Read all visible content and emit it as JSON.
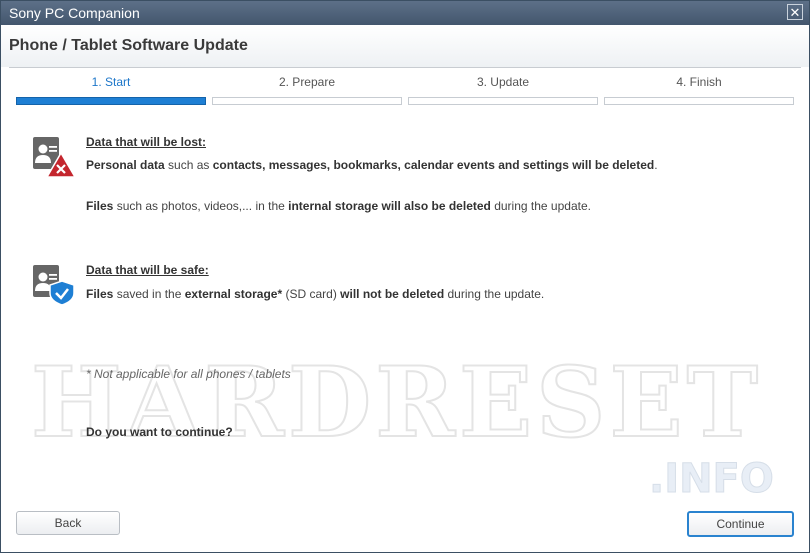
{
  "window": {
    "title": "Sony PC Companion",
    "close_symbol": "✕"
  },
  "header": {
    "title": "Phone / Tablet Software Update"
  },
  "steps": [
    {
      "label": "1. Start",
      "active": true
    },
    {
      "label": "2. Prepare",
      "active": false
    },
    {
      "label": "3. Update",
      "active": false
    },
    {
      "label": "4. Finish",
      "active": false
    }
  ],
  "lost": {
    "heading": "Data that will be lost:",
    "line1": {
      "p1": "Personal data",
      "p2": " such as ",
      "p3": "contacts, messages, bookmarks, calendar events and settings will be deleted",
      "p4": "."
    },
    "line2": {
      "p1": "Files",
      "p2": " such as photos, videos,... in the ",
      "p3": "internal storage will also be deleted",
      "p4": " during the update."
    }
  },
  "safe": {
    "heading": "Data that will be safe:",
    "line1": {
      "p1": "Files",
      "p2": " saved in the ",
      "p3": "external storage*",
      "p4": " (SD card) ",
      "p5": "will not be deleted",
      "p6": " during the update."
    }
  },
  "note": "* Not applicable for all phones / tablets",
  "question": "Do you want to continue?",
  "buttons": {
    "back": "Back",
    "continue": "Continue"
  },
  "watermark": {
    "main": "HARDRESET",
    "sub": ".INFO"
  },
  "colors": {
    "accent": "#1e7fd4",
    "titlebar": "#4d6078",
    "warning_red": "#c4262e",
    "safe_blue": "#1e7fd4"
  }
}
